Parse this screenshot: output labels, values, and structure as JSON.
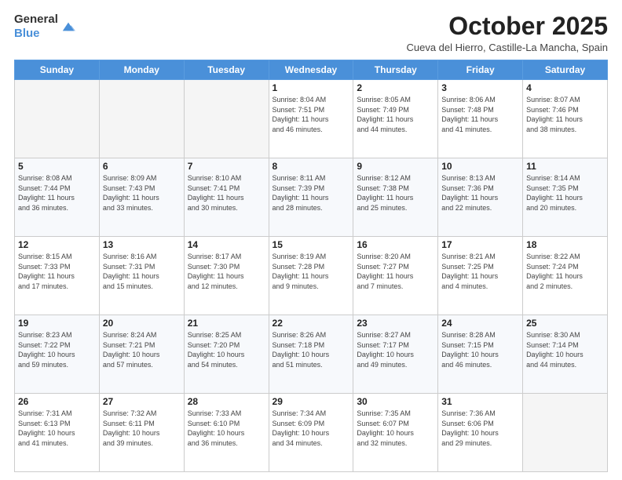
{
  "logo": {
    "text_general": "General",
    "text_blue": "Blue"
  },
  "header": {
    "month": "October 2025",
    "location": "Cueva del Hierro, Castille-La Mancha, Spain"
  },
  "weekdays": [
    "Sunday",
    "Monday",
    "Tuesday",
    "Wednesday",
    "Thursday",
    "Friday",
    "Saturday"
  ],
  "weeks": [
    [
      {
        "day": "",
        "info": ""
      },
      {
        "day": "",
        "info": ""
      },
      {
        "day": "",
        "info": ""
      },
      {
        "day": "1",
        "info": "Sunrise: 8:04 AM\nSunset: 7:51 PM\nDaylight: 11 hours\nand 46 minutes."
      },
      {
        "day": "2",
        "info": "Sunrise: 8:05 AM\nSunset: 7:49 PM\nDaylight: 11 hours\nand 44 minutes."
      },
      {
        "day": "3",
        "info": "Sunrise: 8:06 AM\nSunset: 7:48 PM\nDaylight: 11 hours\nand 41 minutes."
      },
      {
        "day": "4",
        "info": "Sunrise: 8:07 AM\nSunset: 7:46 PM\nDaylight: 11 hours\nand 38 minutes."
      }
    ],
    [
      {
        "day": "5",
        "info": "Sunrise: 8:08 AM\nSunset: 7:44 PM\nDaylight: 11 hours\nand 36 minutes."
      },
      {
        "day": "6",
        "info": "Sunrise: 8:09 AM\nSunset: 7:43 PM\nDaylight: 11 hours\nand 33 minutes."
      },
      {
        "day": "7",
        "info": "Sunrise: 8:10 AM\nSunset: 7:41 PM\nDaylight: 11 hours\nand 30 minutes."
      },
      {
        "day": "8",
        "info": "Sunrise: 8:11 AM\nSunset: 7:39 PM\nDaylight: 11 hours\nand 28 minutes."
      },
      {
        "day": "9",
        "info": "Sunrise: 8:12 AM\nSunset: 7:38 PM\nDaylight: 11 hours\nand 25 minutes."
      },
      {
        "day": "10",
        "info": "Sunrise: 8:13 AM\nSunset: 7:36 PM\nDaylight: 11 hours\nand 22 minutes."
      },
      {
        "day": "11",
        "info": "Sunrise: 8:14 AM\nSunset: 7:35 PM\nDaylight: 11 hours\nand 20 minutes."
      }
    ],
    [
      {
        "day": "12",
        "info": "Sunrise: 8:15 AM\nSunset: 7:33 PM\nDaylight: 11 hours\nand 17 minutes."
      },
      {
        "day": "13",
        "info": "Sunrise: 8:16 AM\nSunset: 7:31 PM\nDaylight: 11 hours\nand 15 minutes."
      },
      {
        "day": "14",
        "info": "Sunrise: 8:17 AM\nSunset: 7:30 PM\nDaylight: 11 hours\nand 12 minutes."
      },
      {
        "day": "15",
        "info": "Sunrise: 8:19 AM\nSunset: 7:28 PM\nDaylight: 11 hours\nand 9 minutes."
      },
      {
        "day": "16",
        "info": "Sunrise: 8:20 AM\nSunset: 7:27 PM\nDaylight: 11 hours\nand 7 minutes."
      },
      {
        "day": "17",
        "info": "Sunrise: 8:21 AM\nSunset: 7:25 PM\nDaylight: 11 hours\nand 4 minutes."
      },
      {
        "day": "18",
        "info": "Sunrise: 8:22 AM\nSunset: 7:24 PM\nDaylight: 11 hours\nand 2 minutes."
      }
    ],
    [
      {
        "day": "19",
        "info": "Sunrise: 8:23 AM\nSunset: 7:22 PM\nDaylight: 10 hours\nand 59 minutes."
      },
      {
        "day": "20",
        "info": "Sunrise: 8:24 AM\nSunset: 7:21 PM\nDaylight: 10 hours\nand 57 minutes."
      },
      {
        "day": "21",
        "info": "Sunrise: 8:25 AM\nSunset: 7:20 PM\nDaylight: 10 hours\nand 54 minutes."
      },
      {
        "day": "22",
        "info": "Sunrise: 8:26 AM\nSunset: 7:18 PM\nDaylight: 10 hours\nand 51 minutes."
      },
      {
        "day": "23",
        "info": "Sunrise: 8:27 AM\nSunset: 7:17 PM\nDaylight: 10 hours\nand 49 minutes."
      },
      {
        "day": "24",
        "info": "Sunrise: 8:28 AM\nSunset: 7:15 PM\nDaylight: 10 hours\nand 46 minutes."
      },
      {
        "day": "25",
        "info": "Sunrise: 8:30 AM\nSunset: 7:14 PM\nDaylight: 10 hours\nand 44 minutes."
      }
    ],
    [
      {
        "day": "26",
        "info": "Sunrise: 7:31 AM\nSunset: 6:13 PM\nDaylight: 10 hours\nand 41 minutes."
      },
      {
        "day": "27",
        "info": "Sunrise: 7:32 AM\nSunset: 6:11 PM\nDaylight: 10 hours\nand 39 minutes."
      },
      {
        "day": "28",
        "info": "Sunrise: 7:33 AM\nSunset: 6:10 PM\nDaylight: 10 hours\nand 36 minutes."
      },
      {
        "day": "29",
        "info": "Sunrise: 7:34 AM\nSunset: 6:09 PM\nDaylight: 10 hours\nand 34 minutes."
      },
      {
        "day": "30",
        "info": "Sunrise: 7:35 AM\nSunset: 6:07 PM\nDaylight: 10 hours\nand 32 minutes."
      },
      {
        "day": "31",
        "info": "Sunrise: 7:36 AM\nSunset: 6:06 PM\nDaylight: 10 hours\nand 29 minutes."
      },
      {
        "day": "",
        "info": ""
      }
    ]
  ]
}
